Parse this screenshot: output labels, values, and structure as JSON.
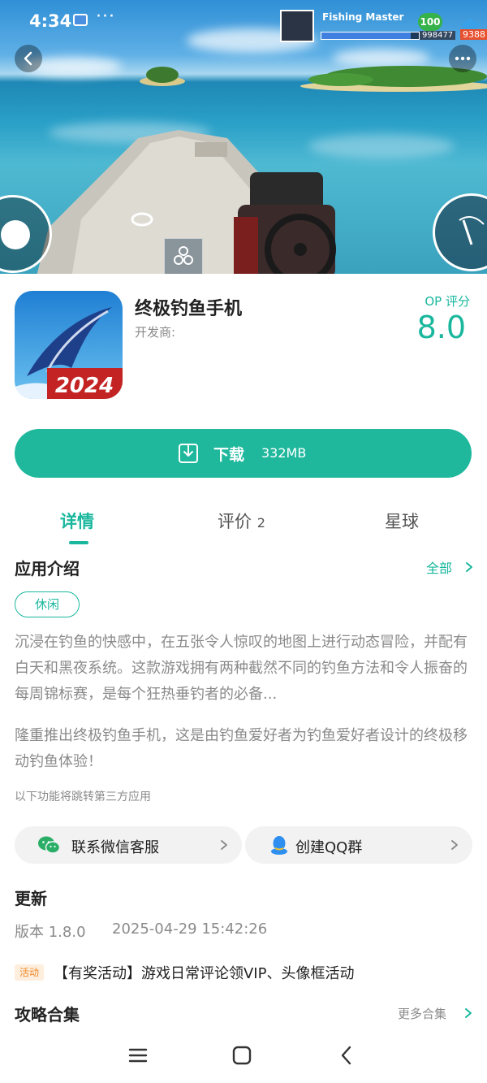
{
  "status_bar": {
    "time": "4:34",
    "more": "···"
  },
  "game_hud": {
    "player_name": "Fishing Master",
    "level": "100",
    "coins": "998477",
    "gems": "9388",
    "xp_fraction": 0.92
  },
  "app": {
    "title": "终极钓鱼手机",
    "developer_label": "开发商:",
    "icon_badge": "2024",
    "rating_label": "OP 评分",
    "rating_value": "8.0"
  },
  "download": {
    "label": "下载",
    "size": "332MB"
  },
  "tabs": [
    {
      "label": "详情",
      "count": ""
    },
    {
      "label": "评价",
      "count": "2"
    },
    {
      "label": "星球",
      "count": ""
    }
  ],
  "intro": {
    "title": "应用介绍",
    "more_label": "全部",
    "tag": "休闲",
    "paragraph1": "沉浸在钓鱼的快感中，在五张令人惊叹的地图上进行动态冒险，并配有白天和黑夜系统。这款游戏拥有两种截然不同的钓鱼方法和令人振奋的每周锦标赛，是每个狂热垂钓者的必备...",
    "paragraph2": "隆重推出终极钓鱼手机，这是由钓鱼爱好者为钓鱼爱好者设计的终极移动钓鱼体验！",
    "third_party_note": "以下功能将跳转第三方应用"
  },
  "contacts": {
    "wechat_label": "联系微信客服",
    "qq_label": "创建QQ群"
  },
  "update": {
    "title": "更新",
    "version": "版本 1.8.0",
    "date": "2025-04-29 15:42:26"
  },
  "activity": {
    "badge": "活动",
    "text": "【有奖活动】游戏日常评论领VIP、头像框活动"
  },
  "guides": {
    "title": "攻略合集",
    "more_label": "更多合集"
  },
  "colors": {
    "accent": "#1fb89d",
    "text": "#222222",
    "muted": "#8a8a8a",
    "activity": "#f08a2b"
  }
}
